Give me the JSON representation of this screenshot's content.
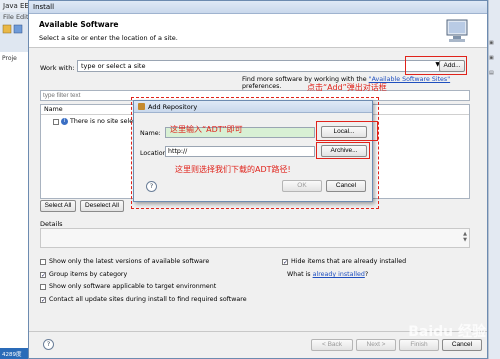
{
  "eclipse": {
    "title": "Java EE",
    "menu": "File  Edit",
    "left_tab": "Proje",
    "status_chip": "4289度"
  },
  "install": {
    "title": "Install",
    "header_title": "Available Software",
    "header_subtitle": "Select a site or enter the location of a site.",
    "work_with_label": "Work with:",
    "site_combo_value": "type or select a site",
    "add_button": "Add...",
    "find_more_prefix": "Find more software by working with the",
    "find_more_link": "\"Available Software Sites\"",
    "find_more_suffix": "preferences.",
    "filter_placeholder": "type filter text",
    "table_header": "Name",
    "table_row": "There is no site selected.",
    "select_all": "Select All",
    "deselect_all": "Deselect All",
    "details_label": "Details",
    "options": {
      "latest": "Show only the latest versions of available software",
      "group": "Group items by category",
      "target": "Show only software applicable to target environment",
      "contact": "Contact all update sites during install to find required software",
      "hide": "Hide items that are already installed"
    },
    "what_installed_prefix": "What is",
    "what_installed_link": "already installed",
    "what_installed_suffix": "?",
    "help": "?",
    "back": "< Back",
    "next": "Next >",
    "finish": "Finish",
    "cancel": "Cancel"
  },
  "add_repository": {
    "title": "Add Repository",
    "name_label": "Name:",
    "local_button": "Local...",
    "location_label": "Location:",
    "location_value": "http://",
    "archive_button": "Archive...",
    "help": "?",
    "ok": "OK",
    "cancel": "Cancel"
  },
  "annotations": {
    "add_hint": "点击“Add”弹出对话框",
    "name_hint": "这里输入“ADT”即可",
    "archive_hint": "这里则选择我们下载的ADT路径!"
  },
  "watermark": "Baidu 经验",
  "colors": {
    "annotation": "#e0231b",
    "link": "#1f4fbf"
  }
}
